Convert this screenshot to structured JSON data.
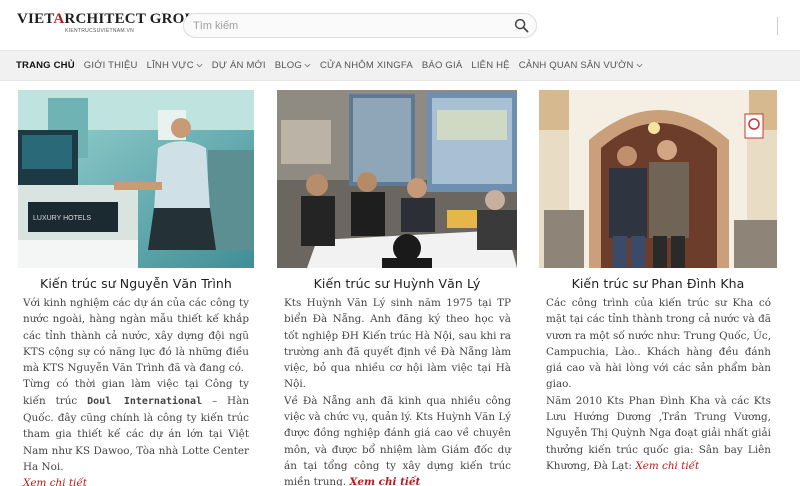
{
  "logo": {
    "prefix": "VIET",
    "accent": "A",
    "rest": "RCHITECT GROUP",
    "sub": "KIENTRUCSUVIETNAM.VN"
  },
  "search": {
    "placeholder": "Tìm kiếm",
    "icon": "search-icon"
  },
  "nav": {
    "items": [
      {
        "label": "TRANG CHỦ",
        "active": true,
        "has_dropdown": false
      },
      {
        "label": "GIỚI THIỆU",
        "active": false,
        "has_dropdown": false
      },
      {
        "label": "LĨNH VỰC",
        "active": false,
        "has_dropdown": true
      },
      {
        "label": "DỰ ÁN MỚI",
        "active": false,
        "has_dropdown": false
      },
      {
        "label": "BLOG",
        "active": false,
        "has_dropdown": true
      },
      {
        "label": "CỬA NHÔM XINGFA",
        "active": false,
        "has_dropdown": false
      },
      {
        "label": "BÁO GIÁ",
        "active": false,
        "has_dropdown": false
      },
      {
        "label": "LIÊN HỆ",
        "active": false,
        "has_dropdown": false
      },
      {
        "label": "CẢNH QUAN SÂN VƯỜN",
        "active": false,
        "has_dropdown": true
      }
    ]
  },
  "cards": [
    {
      "name": "Kiến trúc sư Nguyễn Văn Trình",
      "p1": "Với kinh nghiệm các dự án của các công ty nước ngoài, hàng ngàn mẫu thiết kế khắp các tỉnh thành cả nước, xây dựng đội ngũ KTS cộng sự có năng lực đó là những điều mà KTS Nguyễn Văn Trình đã và đang có.",
      "p2a": "Từng có thời gian làm việc tại Công ty kiến trúc ",
      "p2b": "Doul International",
      "p2c": " – Hàn Quốc. đây cũng chính là công ty kiến trúc tham gia thiết kế các dự án lớn tại Việt Nam như KS Dawoo, Tòa nhà Lotte Center Ha Noi.",
      "link": "Xem chi tiết",
      "photo_label": "LUXURY HOTELS"
    },
    {
      "name": "Kiến trúc sư Huỳnh Văn Lý",
      "p1": "Kts Huỳnh Văn Lý sinh năm 1975 tại TP biển Đà Nẵng. Anh đăng ký theo học và tốt nghiệp ĐH Kiến trúc Hà Nội, sau khi ra trường anh đã quyết định về Đà Nẵng làm việc, bỏ qua nhiều cơ hội làm việc tại Hà Nội.",
      "p2": "Về Đà Nẵng anh đã kinh qua nhiều công việc và chức vụ, quản lý. Kts Huỳnh Văn Lý được đồng nghiệp đánh giá cao về chuyên môn, và được bổ nhiệm làm Giám đốc dự án tại tổng công ty xây dựng kiến trúc miền trung. ",
      "link": "Xem chi tiết"
    },
    {
      "name": "Kiến trúc sư Phan Đình Kha",
      "p1": "Các công trình của kiến trúc sư Kha có mặt tại các tỉnh thành trong cả nước và đã vươn ra một số nước như: Trung Quốc, Úc, Campuchia, Lào.. Khách hàng đều đánh giá cao và hài lòng với các sản phẩm bàn giao.",
      "p2": "Năm 2010 Kts Phan Đình Kha và các Kts Lưu Hướng Dương ,Trần Trung Vương, Nguyễn Thị Quỳnh Nga đoạt giải nhất giải thưởng kiến trúc quốc gia: Sân bay Liên Khương, Đà Lạt: ",
      "link": "Xem chi tiết"
    }
  ],
  "colors": {
    "accent": "#b71c1c",
    "nav_bg": "#f1f1f1",
    "text": "#444444"
  }
}
